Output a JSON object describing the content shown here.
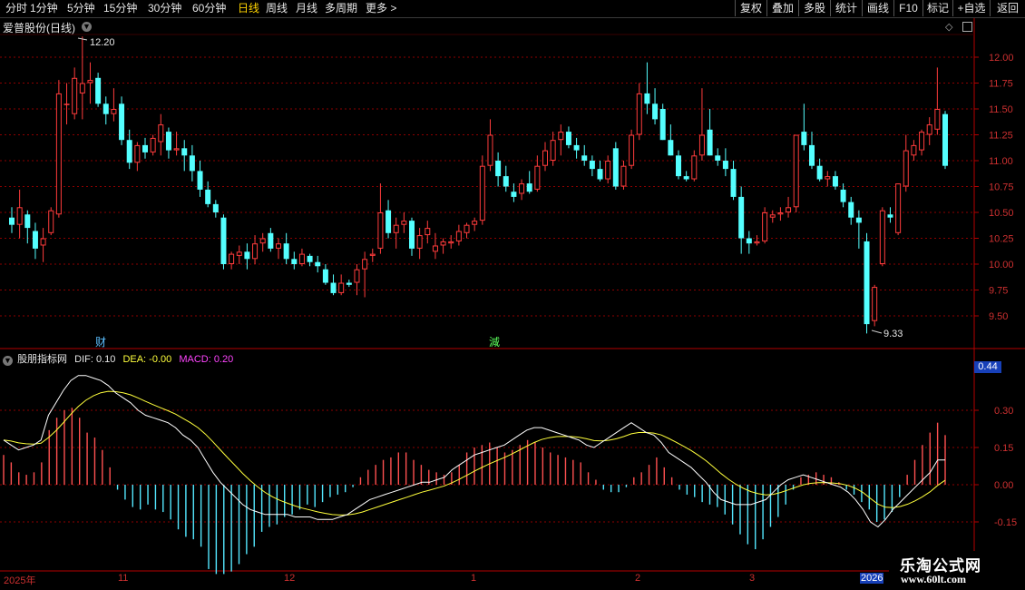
{
  "toolbar": {
    "periods": [
      "分时",
      "1分钟",
      "5分钟",
      "15分钟",
      "30分钟",
      "60分钟",
      "日线",
      "周线",
      "月线",
      "多周期",
      "更多 >"
    ],
    "active": "日线",
    "right_buttons": [
      "复权",
      "叠加",
      "多股",
      "统计",
      "画线",
      "F10",
      "+自选",
      "返回"
    ],
    "mark_label": "标记"
  },
  "price_chart": {
    "title": "爱普股份(日线)",
    "max_label": "12.20",
    "min_label": "9.33",
    "axis_ticks": [
      "12.00",
      "11.75",
      "11.50",
      "11.25",
      "11.00",
      "10.75",
      "10.50",
      "10.25",
      "10.00",
      "9.75",
      "9.50"
    ],
    "markers": [
      {
        "text": "财"
      },
      {
        "text": "減"
      }
    ]
  },
  "indicator": {
    "name": "股朋指标网",
    "dif_label": "DIF: 0.10",
    "dea_label": "DEA: -0.00",
    "macd_label": "MACD: 0.20",
    "value_box": "0.44",
    "axis_ticks": [
      "0.30",
      "0.15",
      "0.00",
      "-0.15"
    ]
  },
  "date_axis": {
    "labels": [
      "2025年",
      "11",
      "12",
      "1",
      "2",
      "3",
      "2026"
    ]
  },
  "watermark": {
    "line1": "乐淘公式网",
    "line2": "www.60lt.com"
  },
  "colors": {
    "up": "#ff3c3c",
    "down": "#54ffff",
    "grid": "#8b0000",
    "dif": "#ffffff",
    "dea": "#ffff3c",
    "macd_label": "#ff44ff",
    "border": "#b40000",
    "active_period": "#ffd400"
  },
  "chart_data": {
    "type": "candlestick",
    "ohlc": [
      [
        10.45,
        10.55,
        10.3,
        10.38
      ],
      [
        10.38,
        10.72,
        10.25,
        10.55
      ],
      [
        10.48,
        10.52,
        10.2,
        10.35
      ],
      [
        10.32,
        10.4,
        10.05,
        10.15
      ],
      [
        10.18,
        10.35,
        10.02,
        10.25
      ],
      [
        10.3,
        10.55,
        10.28,
        10.52
      ],
      [
        10.48,
        11.78,
        10.45,
        11.65
      ],
      [
        11.55,
        11.75,
        11.35,
        11.55
      ],
      [
        11.45,
        11.9,
        11.4,
        11.8
      ],
      [
        11.65,
        12.2,
        11.4,
        11.75
      ],
      [
        11.75,
        11.95,
        11.55,
        11.78
      ],
      [
        11.8,
        11.85,
        11.52,
        11.55
      ],
      [
        11.55,
        11.62,
        11.35,
        11.45
      ],
      [
        11.45,
        11.7,
        11.38,
        11.5
      ],
      [
        11.55,
        11.62,
        11.15,
        11.2
      ],
      [
        11.2,
        11.3,
        10.92,
        10.98
      ],
      [
        10.98,
        11.18,
        10.9,
        11.15
      ],
      [
        11.15,
        11.22,
        11.02,
        11.08
      ],
      [
        11.08,
        11.25,
        11.05,
        11.22
      ],
      [
        11.18,
        11.45,
        11.05,
        11.35
      ],
      [
        11.28,
        11.32,
        11.02,
        11.1
      ],
      [
        11.1,
        11.28,
        11.05,
        11.12
      ],
      [
        11.12,
        11.2,
        10.9,
        11.05
      ],
      [
        11.05,
        11.15,
        10.8,
        10.9
      ],
      [
        10.9,
        11.0,
        10.65,
        10.72
      ],
      [
        10.72,
        10.8,
        10.55,
        10.58
      ],
      [
        10.58,
        10.62,
        10.45,
        10.5
      ],
      [
        10.45,
        10.48,
        9.95,
        10.0
      ],
      [
        10.0,
        10.12,
        9.95,
        10.1
      ],
      [
        10.08,
        10.18,
        10.0,
        10.12
      ],
      [
        10.12,
        10.2,
        9.95,
        10.05
      ],
      [
        10.05,
        10.28,
        10.0,
        10.2
      ],
      [
        10.2,
        10.3,
        10.12,
        10.25
      ],
      [
        10.3,
        10.35,
        10.12,
        10.15
      ],
      [
        10.15,
        10.25,
        10.05,
        10.2
      ],
      [
        10.2,
        10.3,
        10.0,
        10.05
      ],
      [
        10.05,
        10.12,
        9.95,
        10.0
      ],
      [
        10.0,
        10.15,
        9.98,
        10.1
      ],
      [
        10.08,
        10.1,
        9.98,
        10.02
      ],
      [
        10.02,
        10.08,
        9.92,
        9.98
      ],
      [
        9.95,
        10.0,
        9.8,
        9.82
      ],
      [
        9.82,
        9.9,
        9.7,
        9.72
      ],
      [
        9.72,
        9.9,
        9.7,
        9.82
      ],
      [
        9.82,
        9.85,
        9.78,
        9.8
      ],
      [
        9.82,
        10.0,
        9.7,
        9.95
      ],
      [
        9.95,
        10.12,
        9.68,
        10.05
      ],
      [
        10.08,
        10.15,
        10.02,
        10.1
      ],
      [
        10.15,
        10.78,
        10.1,
        10.5
      ],
      [
        10.52,
        10.62,
        10.25,
        10.3
      ],
      [
        10.3,
        10.45,
        10.15,
        10.38
      ],
      [
        10.38,
        10.5,
        10.3,
        10.42
      ],
      [
        10.42,
        10.45,
        10.08,
        10.15
      ],
      [
        10.15,
        10.35,
        10.05,
        10.28
      ],
      [
        10.28,
        10.42,
        10.2,
        10.35
      ],
      [
        10.12,
        10.3,
        10.05,
        10.18
      ],
      [
        10.18,
        10.25,
        10.1,
        10.22
      ],
      [
        10.2,
        10.28,
        10.15,
        10.22
      ],
      [
        10.22,
        10.38,
        10.18,
        10.32
      ],
      [
        10.3,
        10.4,
        10.25,
        10.38
      ],
      [
        10.38,
        10.45,
        10.32,
        10.42
      ],
      [
        10.42,
        11.05,
        10.38,
        10.95
      ],
      [
        10.95,
        11.4,
        10.9,
        11.25
      ],
      [
        11.0,
        11.08,
        10.75,
        10.85
      ],
      [
        10.85,
        10.95,
        10.7,
        10.75
      ],
      [
        10.7,
        10.78,
        10.6,
        10.65
      ],
      [
        10.68,
        10.82,
        10.62,
        10.78
      ],
      [
        10.78,
        10.9,
        10.68,
        10.7
      ],
      [
        10.72,
        11.05,
        10.7,
        10.95
      ],
      [
        10.95,
        11.18,
        10.9,
        11.1
      ],
      [
        11.0,
        11.28,
        10.95,
        11.2
      ],
      [
        11.2,
        11.35,
        11.05,
        11.28
      ],
      [
        11.28,
        11.33,
        11.12,
        11.15
      ],
      [
        11.15,
        11.22,
        11.02,
        11.1
      ],
      [
        11.05,
        11.15,
        10.95,
        11.0
      ],
      [
        11.0,
        11.05,
        10.85,
        10.92
      ],
      [
        10.92,
        11.0,
        10.8,
        10.82
      ],
      [
        10.82,
        11.05,
        10.78,
        11.0
      ],
      [
        11.12,
        11.18,
        10.72,
        10.75
      ],
      [
        10.75,
        11.0,
        10.72,
        10.95
      ],
      [
        10.95,
        11.3,
        10.92,
        11.25
      ],
      [
        11.25,
        11.75,
        11.2,
        11.65
      ],
      [
        11.65,
        11.95,
        11.45,
        11.55
      ],
      [
        11.55,
        11.7,
        11.35,
        11.4
      ],
      [
        11.5,
        11.55,
        11.2,
        11.2
      ],
      [
        11.2,
        11.35,
        11.05,
        11.05
      ],
      [
        11.05,
        11.1,
        10.82,
        10.85
      ],
      [
        10.85,
        10.9,
        10.8,
        10.82
      ],
      [
        10.82,
        11.1,
        10.8,
        11.05
      ],
      [
        11.05,
        11.7,
        11.0,
        11.25
      ],
      [
        11.3,
        11.5,
        11.05,
        11.05
      ],
      [
        11.05,
        11.12,
        10.95,
        11.0
      ],
      [
        11.0,
        11.12,
        10.85,
        10.92
      ],
      [
        10.92,
        11.0,
        10.62,
        10.65
      ],
      [
        10.65,
        10.75,
        10.1,
        10.25
      ],
      [
        10.25,
        10.32,
        10.1,
        10.2
      ],
      [
        10.2,
        10.28,
        10.18,
        10.22
      ],
      [
        10.22,
        10.55,
        10.2,
        10.5
      ],
      [
        10.45,
        10.52,
        10.4,
        10.48
      ],
      [
        10.48,
        10.55,
        10.42,
        10.5
      ],
      [
        10.5,
        10.65,
        10.45,
        10.55
      ],
      [
        10.55,
        11.25,
        10.5,
        11.25
      ],
      [
        11.28,
        11.55,
        11.1,
        11.15
      ],
      [
        11.15,
        11.28,
        10.92,
        10.95
      ],
      [
        10.95,
        11.02,
        10.8,
        10.82
      ],
      [
        10.82,
        10.9,
        10.75,
        10.85
      ],
      [
        10.85,
        10.9,
        10.72,
        10.75
      ],
      [
        10.72,
        10.78,
        10.55,
        10.6
      ],
      [
        10.6,
        10.65,
        10.38,
        10.45
      ],
      [
        10.45,
        10.52,
        10.15,
        10.4
      ],
      [
        10.22,
        10.3,
        9.33,
        9.42
      ],
      [
        9.45,
        9.8,
        9.4,
        9.78
      ],
      [
        10.0,
        10.55,
        9.98,
        10.52
      ],
      [
        10.48,
        10.55,
        10.4,
        10.45
      ],
      [
        10.3,
        10.78,
        10.28,
        10.78
      ],
      [
        10.75,
        11.25,
        10.7,
        11.1
      ],
      [
        11.05,
        11.2,
        11.0,
        11.15
      ],
      [
        11.1,
        11.3,
        11.05,
        11.28
      ],
      [
        11.25,
        11.42,
        11.15,
        11.35
      ],
      [
        11.3,
        11.9,
        11.25,
        11.5
      ],
      [
        11.45,
        11.48,
        10.92,
        10.95
      ]
    ],
    "macd_hist": [
      0.12,
      0.09,
      0.05,
      0.04,
      0.05,
      0.09,
      0.22,
      0.27,
      0.3,
      0.31,
      0.27,
      0.21,
      0.19,
      0.14,
      0.07,
      -0.02,
      -0.06,
      -0.09,
      -0.1,
      -0.08,
      -0.1,
      -0.11,
      -0.14,
      -0.18,
      -0.21,
      -0.22,
      -0.25,
      -0.34,
      -0.36,
      -0.36,
      -0.35,
      -0.32,
      -0.28,
      -0.25,
      -0.19,
      -0.17,
      -0.16,
      -0.13,
      -0.12,
      -0.1,
      -0.08,
      -0.09,
      -0.07,
      -0.05,
      -0.04,
      -0.03,
      -0.01,
      0.03,
      0.06,
      0.08,
      0.1,
      0.11,
      0.13,
      0.13,
      0.1,
      0.08,
      0.06,
      0.05,
      0.04,
      0.05,
      0.08,
      0.13,
      0.15,
      0.16,
      0.17,
      0.15,
      0.13,
      0.14,
      0.16,
      0.18,
      0.17,
      0.15,
      0.13,
      0.12,
      0.11,
      0.1,
      0.09,
      0.05,
      0.02,
      -0.02,
      -0.03,
      -0.03,
      -0.01,
      0.03,
      0.05,
      0.08,
      0.11,
      0.07,
      0.03,
      -0.02,
      -0.04,
      -0.05,
      -0.07,
      -0.08,
      -0.09,
      -0.12,
      -0.16,
      -0.2,
      -0.24,
      -0.26,
      -0.22,
      -0.17,
      -0.13,
      -0.08,
      -0.02,
      0.03,
      0.04,
      0.05,
      0.04,
      0.03,
      0.01,
      -0.02,
      -0.04,
      -0.07,
      -0.1,
      -0.15,
      -0.14,
      -0.11,
      -0.05,
      0.04,
      0.1,
      0.16,
      0.21,
      0.25,
      0.2
    ],
    "dif": [
      0.18,
      0.16,
      0.14,
      0.15,
      0.16,
      0.18,
      0.28,
      0.33,
      0.38,
      0.42,
      0.44,
      0.44,
      0.43,
      0.42,
      0.4,
      0.37,
      0.35,
      0.33,
      0.3,
      0.28,
      0.27,
      0.26,
      0.25,
      0.23,
      0.2,
      0.18,
      0.15,
      0.1,
      0.05,
      0.01,
      -0.02,
      -0.05,
      -0.08,
      -0.1,
      -0.11,
      -0.12,
      -0.12,
      -0.12,
      -0.12,
      -0.13,
      -0.13,
      -0.13,
      -0.14,
      -0.14,
      -0.14,
      -0.13,
      -0.12,
      -0.1,
      -0.08,
      -0.06,
      -0.05,
      -0.04,
      -0.03,
      -0.02,
      -0.01,
      0.0,
      0.01,
      0.01,
      0.02,
      0.03,
      0.06,
      0.08,
      0.1,
      0.12,
      0.13,
      0.14,
      0.15,
      0.16,
      0.18,
      0.2,
      0.22,
      0.23,
      0.23,
      0.22,
      0.21,
      0.2,
      0.19,
      0.18,
      0.16,
      0.15,
      0.17,
      0.19,
      0.21,
      0.23,
      0.25,
      0.23,
      0.21,
      0.2,
      0.17,
      0.13,
      0.11,
      0.09,
      0.07,
      0.04,
      0.01,
      -0.03,
      -0.06,
      -0.07,
      -0.08,
      -0.08,
      -0.08,
      -0.07,
      -0.06,
      -0.03,
      0.0,
      0.02,
      0.03,
      0.04,
      0.03,
      0.02,
      0.01,
      0.0,
      -0.01,
      -0.03,
      -0.06,
      -0.1,
      -0.15,
      -0.17,
      -0.14,
      -0.1,
      -0.07,
      -0.04,
      -0.01,
      0.02,
      0.05,
      0.1,
      0.1
    ]
  }
}
